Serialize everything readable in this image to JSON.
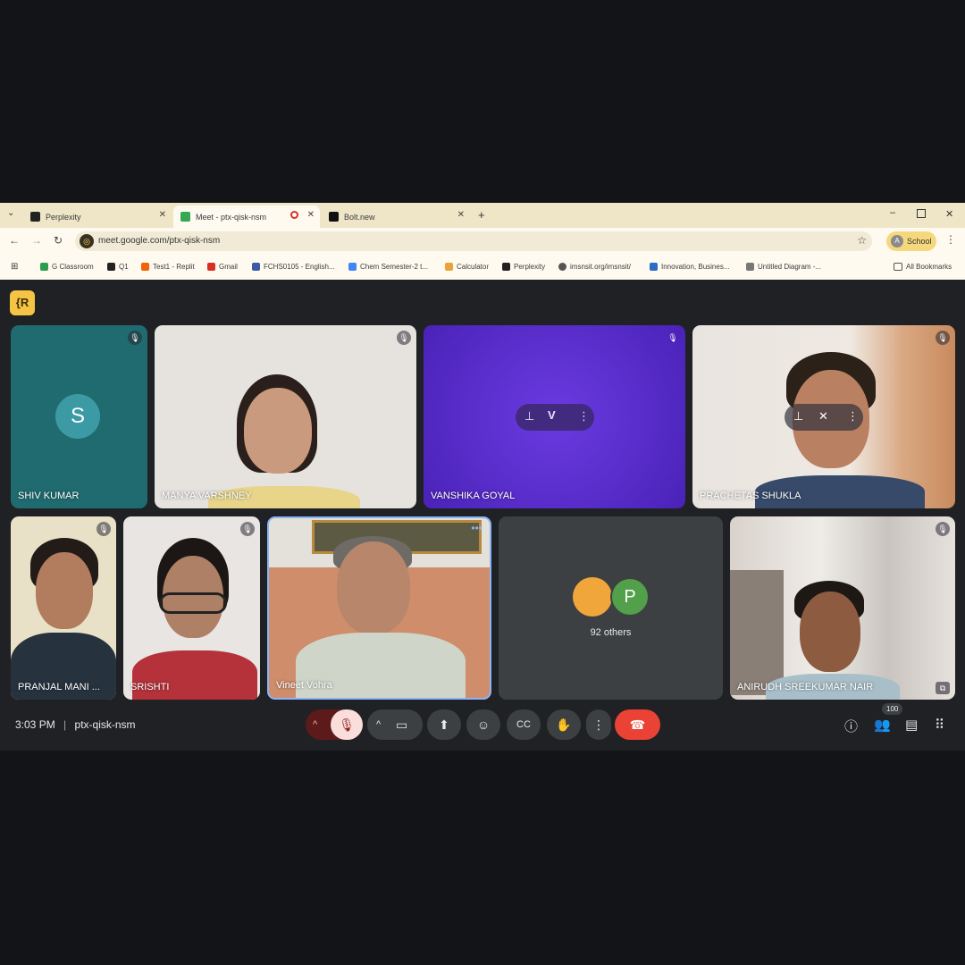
{
  "tabs": [
    {
      "title": "Perplexity"
    },
    {
      "title": "Meet - ptx-qisk-nsm"
    },
    {
      "title": "Bolt.new"
    }
  ],
  "address": {
    "url": "meet.google.com/ptx-qisk-nsm"
  },
  "profile": {
    "initial": "A",
    "label": "School"
  },
  "bookmarks": [
    {
      "label": "G Classroom",
      "color": "#2e9d4f"
    },
    {
      "label": "Q1",
      "color": "#222222"
    },
    {
      "label": "Test1 - Replit",
      "color": "#f26207"
    },
    {
      "label": "Gmail",
      "color": "#d93025"
    },
    {
      "label": "FCHS0105 - English...",
      "color": "#3b5ba9"
    },
    {
      "label": "Chem Semester-2 t...",
      "color": "#4285f4"
    },
    {
      "label": "Calculator",
      "color": "#e8a33d"
    },
    {
      "label": "Perplexity",
      "color": "#222222"
    },
    {
      "label": "imsnsit.org/imsnsit/",
      "color": "#555555"
    },
    {
      "label": "Innovation, Busines...",
      "color": "#2b6cc4"
    },
    {
      "label": "Untitled Diagram -...",
      "color": "#777777"
    }
  ],
  "all_bookmarks": "All Bookmarks",
  "meet_logo_text": "{R",
  "participants": [
    {
      "name": "SHIV KUMAR",
      "avatar": "S"
    },
    {
      "name": "MANYA VARSHNEY"
    },
    {
      "name": "VANSHIKA GOYAL"
    },
    {
      "name": "PRACHETAS SHUKLA"
    },
    {
      "name": "PRANJAL MANI ..."
    },
    {
      "name": "SRISHTI"
    },
    {
      "name": "Vineet Vohra"
    },
    {
      "name": "ANIRUDH SREEKUMAR NAIR"
    }
  ],
  "others": {
    "label": "92 others",
    "avatar_letter": "P"
  },
  "meeting": {
    "time": "3:03 PM",
    "separator": "|",
    "code": "ptx-qisk-nsm"
  },
  "people_count": "100",
  "colors": {
    "accent": "#ea4335",
    "tile_shiv": "#1f6b70",
    "tile_vanshika": "#5b2ec6"
  }
}
